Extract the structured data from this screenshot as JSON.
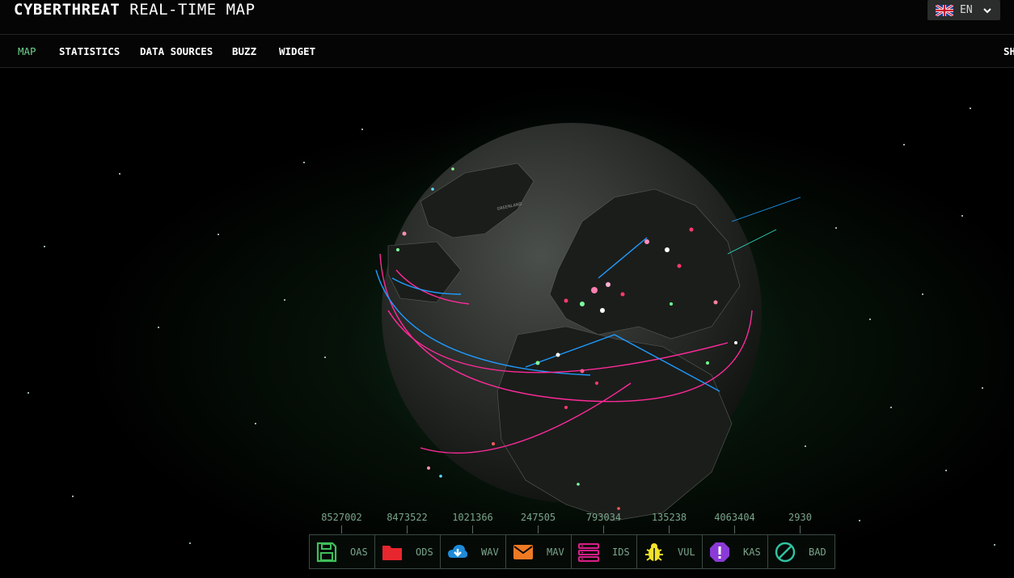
{
  "header": {
    "brand_bold": "CYBERTHREAT",
    "brand_rest": "REAL-TIME MAP",
    "language": "EN"
  },
  "nav": {
    "items": [
      "MAP",
      "STATISTICS",
      "DATA SOURCES",
      "BUZZ",
      "WIDGET"
    ],
    "active": "MAP",
    "overflow": "SH"
  },
  "globe": {
    "region_label": "GREENLAND"
  },
  "stats": [
    {
      "code": "OAS",
      "count": "8527002",
      "color": "#3fbf5a",
      "icon": "floppy-disk-icon"
    },
    {
      "code": "ODS",
      "count": "8473522",
      "color": "#e8262e",
      "icon": "folder-icon"
    },
    {
      "code": "WAV",
      "count": "1021366",
      "color": "#1e8bd9",
      "icon": "cloud-download-icon"
    },
    {
      "code": "MAV",
      "count": "247505",
      "color": "#f07a24",
      "icon": "envelope-icon"
    },
    {
      "code": "IDS",
      "count": "793034",
      "color": "#d91f8a",
      "icon": "server-stack-icon"
    },
    {
      "code": "VUL",
      "count": "135238",
      "color": "#f2e22a",
      "icon": "bug-icon"
    },
    {
      "code": "KAS",
      "count": "4063404",
      "color": "#8a3ad6",
      "icon": "alert-octagon-icon"
    },
    {
      "code": "BAD",
      "count": "2930",
      "color": "#2fc4a0",
      "icon": "block-icon"
    }
  ]
}
